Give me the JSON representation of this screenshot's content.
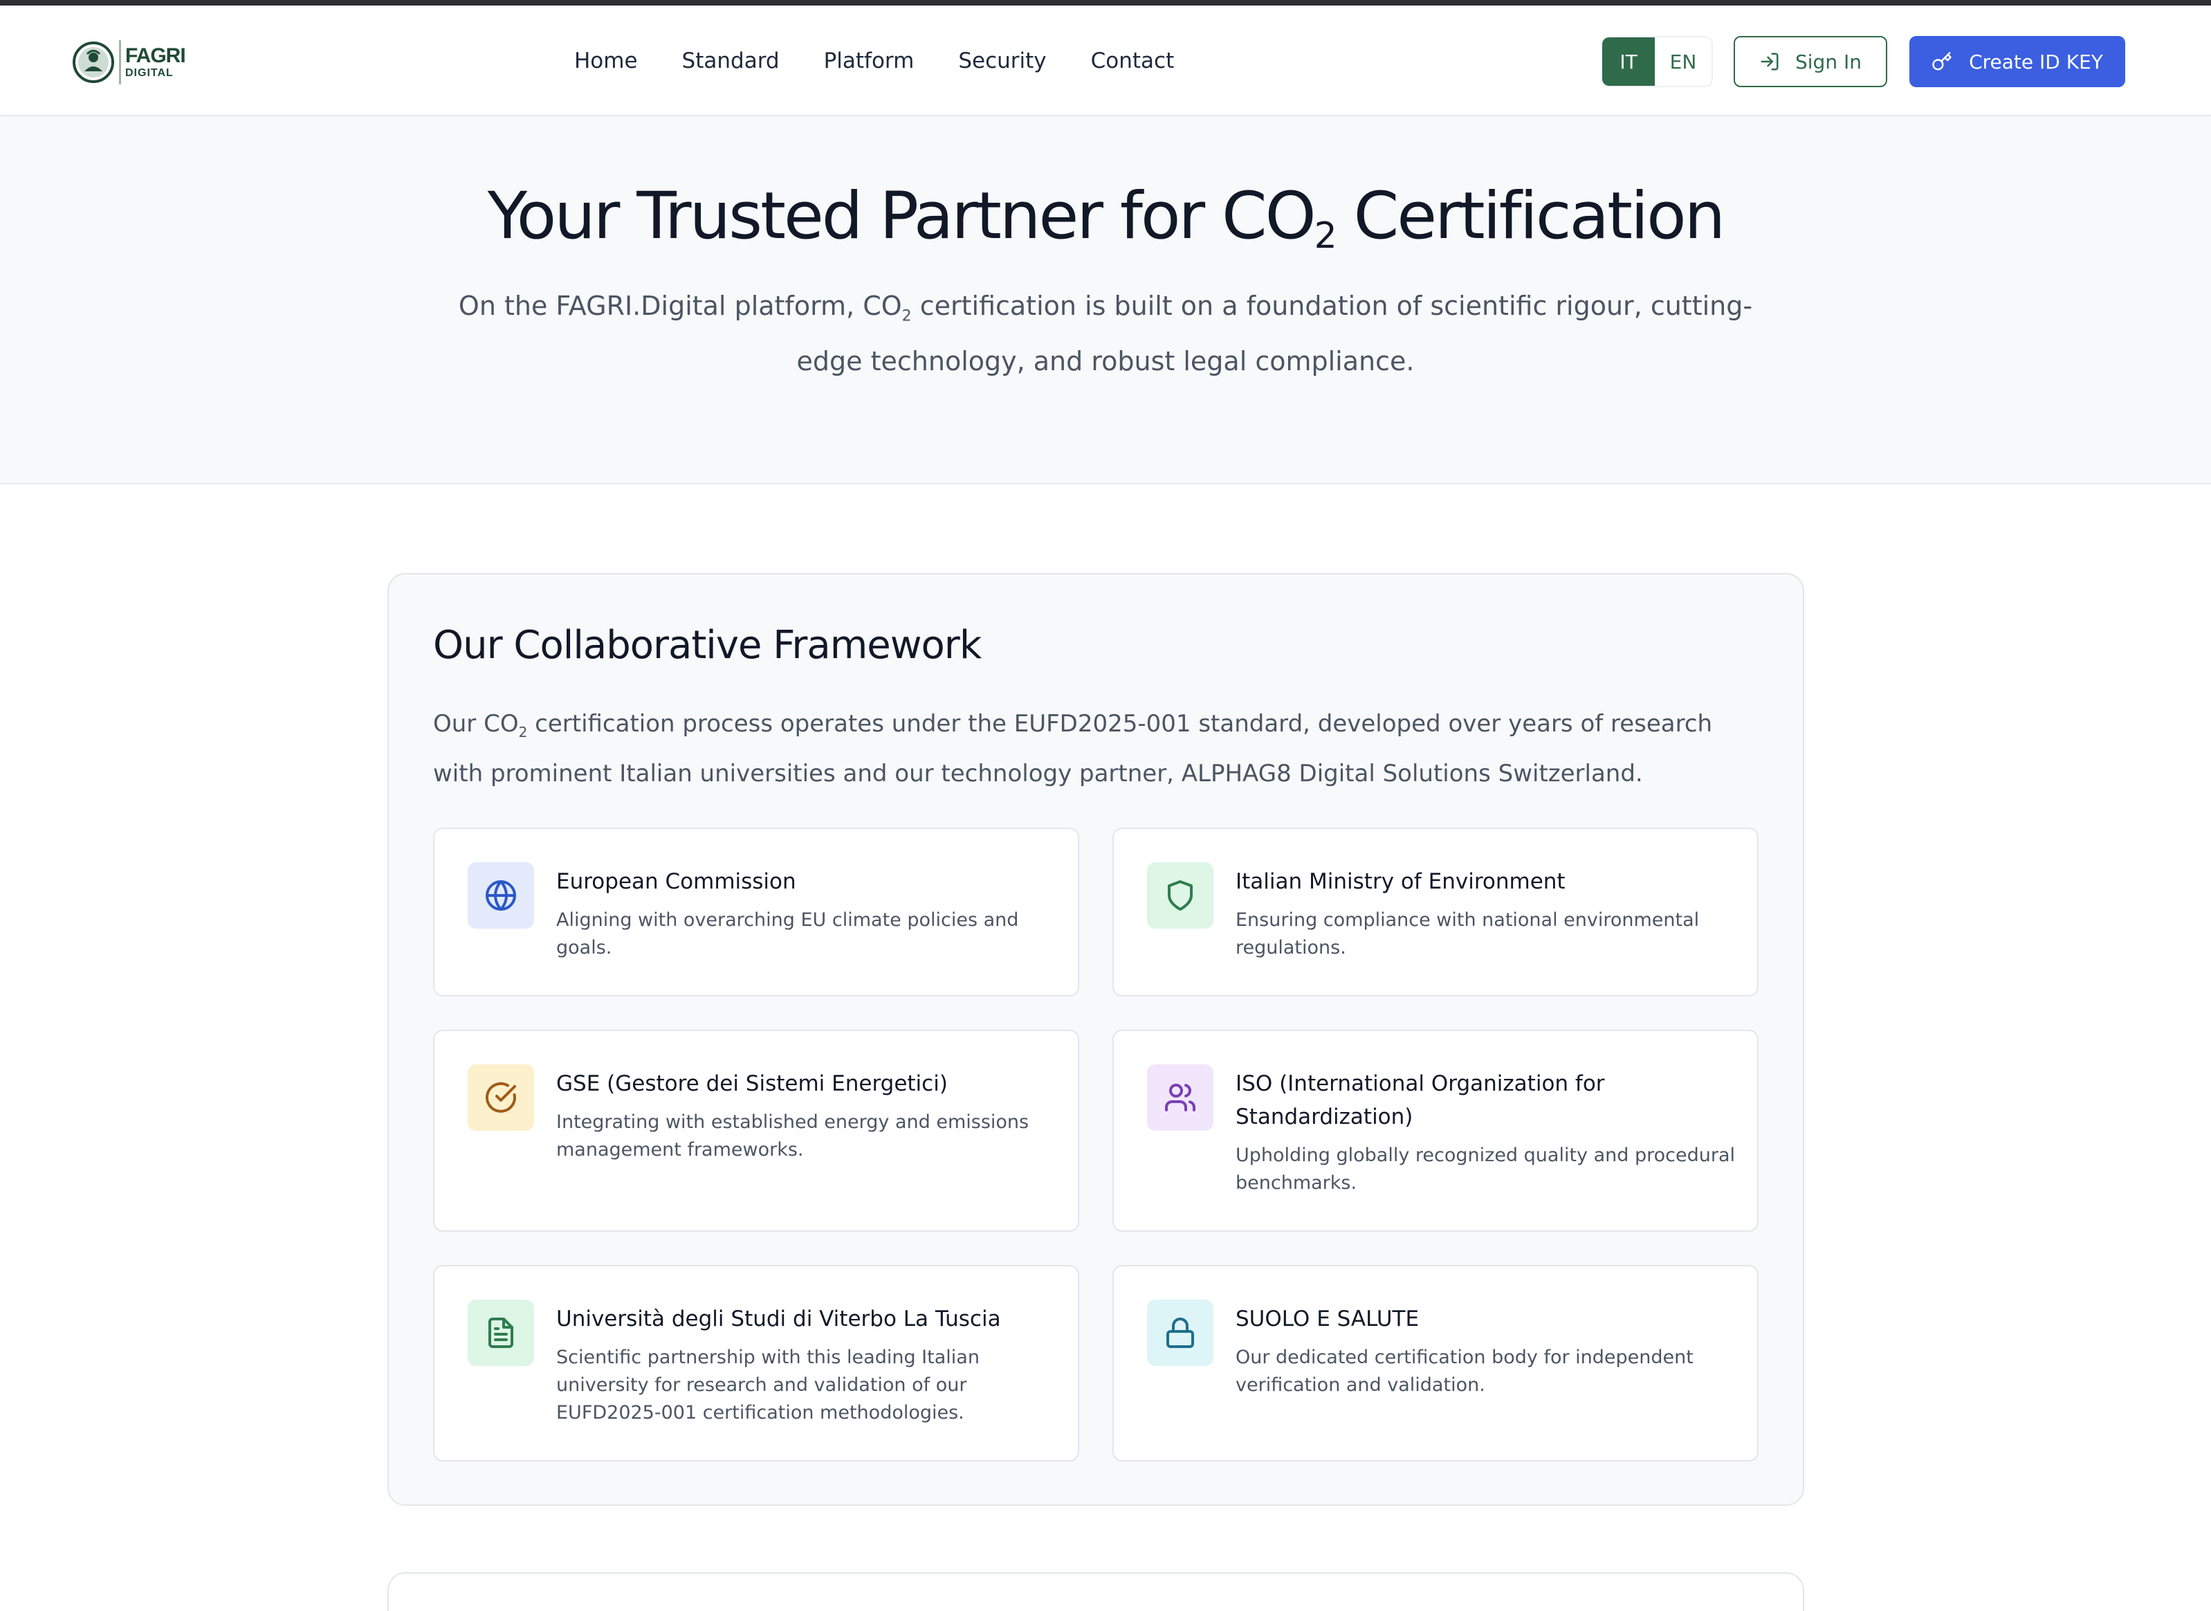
{
  "brand": {
    "line1": "FAGRI",
    "line2": "DIGITAL"
  },
  "nav": {
    "items": [
      "Home",
      "Standard",
      "Platform",
      "Security",
      "Contact"
    ],
    "lang": {
      "it": "IT",
      "en": "EN",
      "active": "IT"
    },
    "signin_label": "Sign In",
    "create_label": "Create ID KEY"
  },
  "hero": {
    "title_pre": "Your Trusted Partner for CO",
    "title_sub": "2",
    "title_post": " Certification",
    "desc_pre": "On the FAGRI.Digital platform, CO",
    "desc_sub": "2",
    "desc_post": " certification is built on a foundation of scientific rigour, cutting-edge technology, and robust legal compliance."
  },
  "framework": {
    "title": "Our Collaborative Framework",
    "intro_pre": "Our CO",
    "intro_sub": "2",
    "intro_post": " certification process operates under the EUFD2025-001 standard, developed over years of research with prominent Italian universities and our technology partner, ALPHAG8 Digital Solutions Switzerland.",
    "cards": [
      {
        "icon": "globe-icon",
        "icon_color": "#2b57c9",
        "icon_bg": "#e2eafb",
        "title": "European Commission",
        "desc": "Aligning with overarching EU climate policies and goals."
      },
      {
        "icon": "shield-icon",
        "icon_color": "#2f7d4e",
        "icon_bg": "#def6e6",
        "title": "Italian Ministry of Environment",
        "desc": "Ensuring compliance with national environmental regulations."
      },
      {
        "icon": "check-circle-icon",
        "icon_color": "#a05a16",
        "icon_bg": "#fdf0cc",
        "title": "GSE (Gestore dei Sistemi Energetici)",
        "desc": "Integrating with established energy and emissions management frameworks."
      },
      {
        "icon": "users-icon",
        "icon_color": "#7a3fb5",
        "icon_bg": "#f1e6fb",
        "title": "ISO (International Organization for Standardization)",
        "desc": "Upholding globally recognized quality and procedural benchmarks."
      },
      {
        "icon": "document-icon",
        "icon_color": "#2f7d4e",
        "icon_bg": "#def6e6",
        "title": "Università degli Studi di Viterbo La Tuscia",
        "desc": "Scientific partnership with this leading Italian university for research and validation of our EUFD2025-001 certification methodologies."
      },
      {
        "icon": "lock-icon",
        "icon_color": "#1f6f8b",
        "icon_bg": "#def5f8",
        "title": "SUOLO E SALUTE",
        "desc": "Our dedicated certification body for independent verification and validation."
      }
    ]
  },
  "colors": {
    "brand_green": "#2f6b4a",
    "primary_blue": "#3b5fe0"
  }
}
